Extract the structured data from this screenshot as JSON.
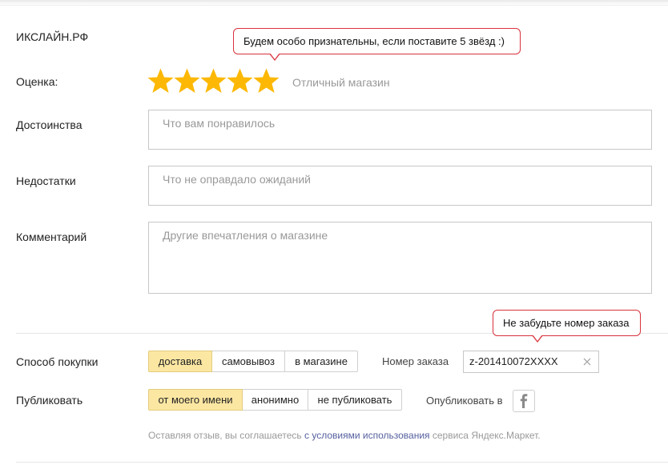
{
  "shop": {
    "name": "ИКСЛАЙН.РФ"
  },
  "tooltips": {
    "stars": "Будем особо признательны, если поставите 5 звёзд :)",
    "order": "Не забудьте номер заказа"
  },
  "rating": {
    "label": "Оценка:",
    "value": 5,
    "max": 5,
    "text": "Отличный магазин",
    "star_color": "#fcb804"
  },
  "fields": {
    "pros": {
      "label": "Достоинства",
      "placeholder": "Что вам понравилось",
      "value": ""
    },
    "cons": {
      "label": "Недостатки",
      "placeholder": "Что не оправдало ожиданий",
      "value": ""
    },
    "comment": {
      "label": "Комментарий",
      "placeholder": "Другие впечатления о магазине",
      "value": ""
    }
  },
  "purchase": {
    "label": "Способ покупки",
    "options": [
      "доставка",
      "самовывоз",
      "в магазине"
    ],
    "selected": "доставка"
  },
  "order": {
    "label": "Номер заказа",
    "value": "z-201410072XXXX"
  },
  "publish": {
    "label": "Публиковать",
    "options": [
      "от моего имени",
      "анонимно",
      "не публиковать"
    ],
    "selected": "от моего имени",
    "publish_in_label": "Опубликовать в",
    "social_icon": "facebook-icon"
  },
  "agreement": {
    "prefix": "Оставляя отзыв, вы соглашаетесь ",
    "link": "с условиями использования",
    "suffix": " сервиса Яндекс.Маркет."
  },
  "colors": {
    "accent_selected": "#fce7a2",
    "tooltip_border": "#d8323c",
    "link": "#555f9e"
  }
}
